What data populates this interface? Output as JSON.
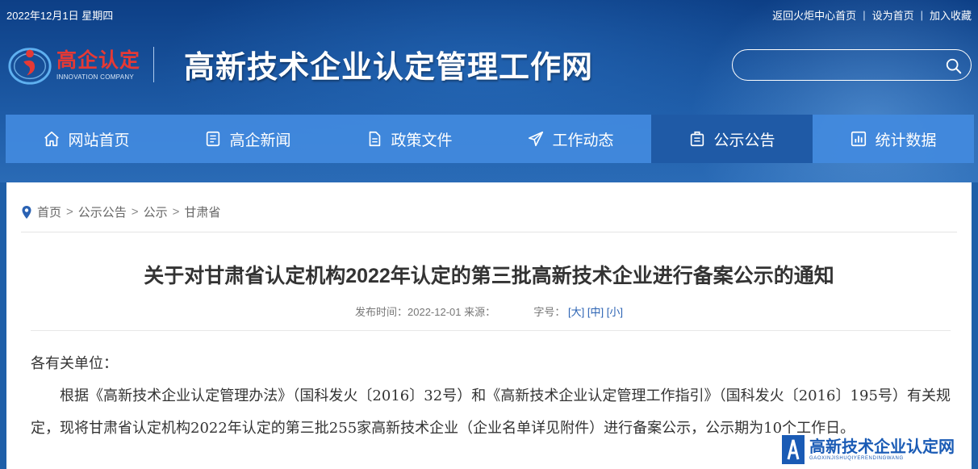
{
  "topbar": {
    "date": "2022年12月1日 星期四",
    "links": [
      "返回火炬中心首页",
      "设为首页",
      "加入收藏"
    ]
  },
  "logo": {
    "brand_cn": "高企认定",
    "brand_en": "INNOVATION COMPANY"
  },
  "site_title": "高新技术企业认定管理工作网",
  "search": {
    "value": "",
    "placeholder": ""
  },
  "nav": [
    {
      "label": "网站首页",
      "icon": "home-icon"
    },
    {
      "label": "高企新闻",
      "icon": "news-icon"
    },
    {
      "label": "政策文件",
      "icon": "document-icon"
    },
    {
      "label": "工作动态",
      "icon": "send-icon"
    },
    {
      "label": "公示公告",
      "icon": "notice-icon",
      "active": true
    },
    {
      "label": "统计数据",
      "icon": "chart-icon"
    }
  ],
  "breadcrumb": [
    "首页",
    "公示公告",
    "公示",
    "甘肃省"
  ],
  "article": {
    "title": "关于对甘肃省认定机构2022年认定的第三批高新技术企业进行备案公示的通知",
    "meta_published": "发布时间：2022-12-01 来源：",
    "meta_fontsize_label": "字号：",
    "fontsize_large": "[大]",
    "fontsize_medium": "[中]",
    "fontsize_small": "[小]",
    "salutation": "各有关单位：",
    "paragraph": "根据《高新技术企业认定管理办法》（国科发火〔2016〕32号）和《高新技术企业认定管理工作指引》（国科发火〔2016〕195号）有关规定，现将甘肃省认定机构2022年认定的第三批255家高新技术企业（企业名单详见附件）进行备案公示，公示期为10个工作日。"
  },
  "watermark": {
    "cn": "高新技术企业认定网",
    "en": "GAOXINJISHUQIYERENDINGWANG"
  },
  "colors": {
    "header_dark": "#0d3f86",
    "nav_bar": "#428ade",
    "nav_active": "#1f5aa6",
    "brand_red": "#e53935",
    "link_blue": "#2a62b3",
    "watermark_blue": "#1a5bb5"
  }
}
